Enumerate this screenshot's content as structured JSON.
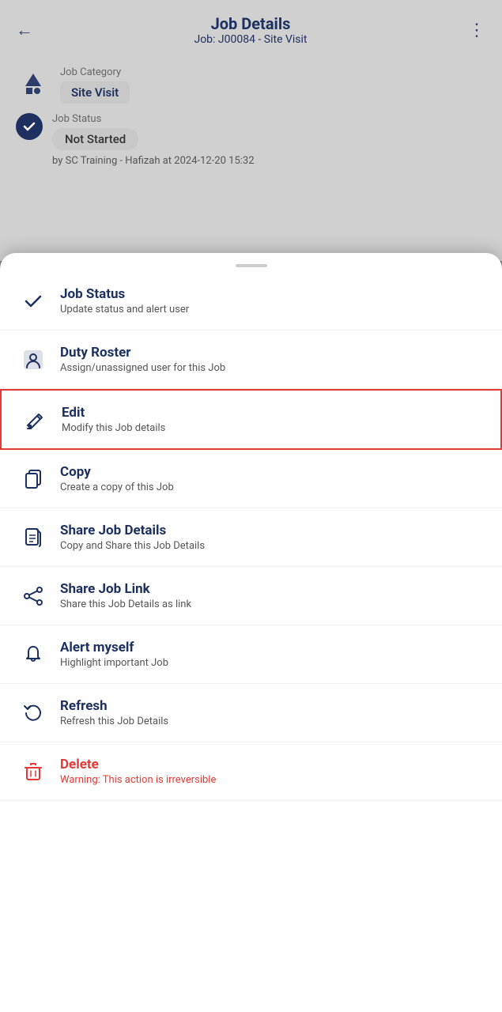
{
  "header": {
    "back_label": "←",
    "title": "Job Details",
    "subtitle": "Job: J00084 - Site Visit",
    "more_icon": "⋮"
  },
  "job_info": {
    "category_label": "Job Category",
    "category_value": "Site Visit",
    "status_label": "Job Status",
    "status_value": "Not Started",
    "updated_by": "by SC Training - Hafizah at 2024-12-20 15:32"
  },
  "sheet": {
    "handle_label": "drag-handle"
  },
  "menu_items": [
    {
      "id": "job-status",
      "title": "Job Status",
      "subtitle": "Update status and alert user",
      "icon": "check",
      "highlighted": false,
      "red": false
    },
    {
      "id": "duty-roster",
      "title": "Duty Roster",
      "subtitle": "Assign/unassigned user for this Job",
      "icon": "person",
      "highlighted": false,
      "red": false
    },
    {
      "id": "edit",
      "title": "Edit",
      "subtitle": "Modify this Job details",
      "icon": "pencil",
      "highlighted": true,
      "red": false
    },
    {
      "id": "copy",
      "title": "Copy",
      "subtitle": "Create a copy of this Job",
      "icon": "copy",
      "highlighted": false,
      "red": false
    },
    {
      "id": "share-details",
      "title": "Share Job Details",
      "subtitle": "Copy and Share this Job Details",
      "icon": "share-doc",
      "highlighted": false,
      "red": false
    },
    {
      "id": "share-link",
      "title": "Share Job Link",
      "subtitle": "Share this Job Details as link",
      "icon": "share",
      "highlighted": false,
      "red": false
    },
    {
      "id": "alert-myself",
      "title": "Alert myself",
      "subtitle": "Highlight important Job",
      "icon": "bell",
      "highlighted": false,
      "red": false
    },
    {
      "id": "refresh",
      "title": "Refresh",
      "subtitle": "Refresh this Job Details",
      "icon": "refresh",
      "highlighted": false,
      "red": false
    },
    {
      "id": "delete",
      "title": "Delete",
      "subtitle": "Warning: This action is irreversible",
      "icon": "trash",
      "highlighted": false,
      "red": true
    }
  ]
}
